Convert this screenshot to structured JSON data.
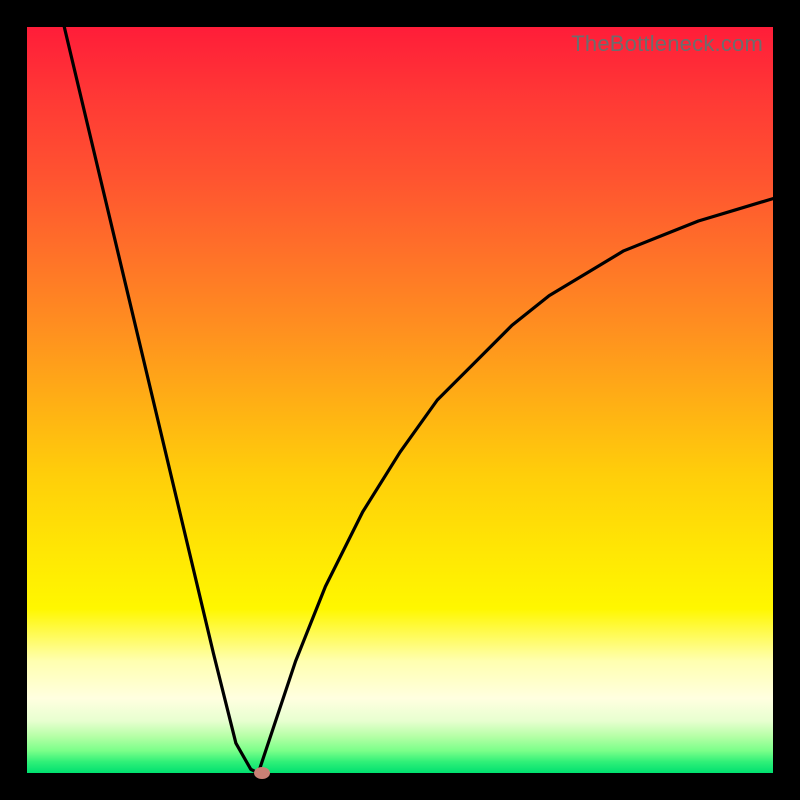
{
  "watermark": "TheBottleneck.com",
  "colors": {
    "frame": "#000000",
    "marker": "#c98075",
    "curve": "#000000"
  },
  "chart_data": {
    "type": "line",
    "title": "",
    "xlabel": "",
    "ylabel": "",
    "xlim": [
      0,
      100
    ],
    "ylim": [
      0,
      100
    ],
    "grid": false,
    "legend": false,
    "series": [
      {
        "name": "left-branch",
        "x": [
          5,
          10,
          15,
          20,
          25,
          28,
          30,
          31
        ],
        "values": [
          100,
          79,
          58,
          37,
          16,
          4,
          0.5,
          0
        ]
      },
      {
        "name": "right-branch",
        "x": [
          31,
          33,
          36,
          40,
          45,
          50,
          55,
          60,
          65,
          70,
          75,
          80,
          85,
          90,
          95,
          100
        ],
        "values": [
          0,
          6,
          15,
          25,
          35,
          43,
          50,
          55,
          60,
          64,
          67,
          70,
          72,
          74,
          75.5,
          77
        ]
      }
    ],
    "marker": {
      "x": 31.5,
      "y": 0
    },
    "annotations": []
  }
}
